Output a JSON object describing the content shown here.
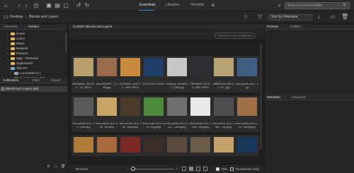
{
  "topbar": {
    "workspaces": [
      "Essentials",
      "Libraries",
      "Filmstrip"
    ],
    "search_placeholder": "Search Current Folder"
  },
  "pathbar": {
    "crumbs": [
      "Desktop",
      "Blends and Layers"
    ],
    "sort_label": "Sort by Filename"
  },
  "left_panel": {
    "tabs": [
      "Favorites",
      "Folders"
    ],
    "tree": [
      {
        "label": "Home",
        "icon": "folder"
      },
      {
        "label": "Junior",
        "icon": "folder"
      },
      {
        "label": "Music",
        "icon": "folder"
      },
      {
        "label": "Network",
        "icon": "folder"
      },
      {
        "label": "Pictures",
        "icon": "folder"
      },
      {
        "label": "Saje - Personal",
        "icon": "folder"
      },
      {
        "label": "Sophomore",
        "icon": "folder"
      },
      {
        "label": "This PC",
        "icon": "pc"
      },
      {
        "label": "Local Disk (C:)",
        "icon": "disk"
      },
      {
        "label": "Google Drive (G:)",
        "icon": "gdrive"
      },
      {
        "label": "My Drive",
        "icon": "folder"
      },
      {
        "label": "Academic Archive",
        "icon": "folder"
      }
    ]
  },
  "collections_panel": {
    "tabs": [
      "Collections",
      "Filter",
      "Export"
    ],
    "items": [
      {
        "label": "Blends and Layers (86)"
      }
    ]
  },
  "content": {
    "title": "Content: Blends and Layers",
    "remove_button": "Remove From Collection",
    "items_count": "86 items",
    "tiles_label": "Tiles",
    "thumbs_label": "Thumbnails Only",
    "files": [
      {
        "label": "A6FBB6A-7DF B-4...2C.JPEG",
        "color": "#b9a06a"
      },
      {
        "label": "b4d-899f337_1 280.jpg",
        "color": "#9a6b4a"
      },
      {
        "label": "C47506C-4AD F-4...A6F.JPEG",
        "color": "#c98a3d"
      },
      {
        "label": "DSC01447.JPEG",
        "color": "#1f3f6a"
      },
      {
        "label": "embeze-9F288 67_1280.jpg",
        "color": "#c7c7c7"
      },
      {
        "label": "F0E9E82-210 9-4...B62.JPEG",
        "color": "#2f2f33"
      },
      {
        "label": "f8B8F241-859 f-f...bf...jpg",
        "color": "#b8a274"
      },
      {
        "label": "free-photo-of-a ...jpg",
        "color": "#3e5f82"
      },
      {
        "label": "free-photo-of-a -cu...own.jpg",
        "color": "#5a5a5a"
      },
      {
        "label": "free-photo-of-a -hot...ze.jpeg",
        "color": "#c9a468"
      },
      {
        "label": "free-photo-of-a -far...loor.jpeg",
        "color": "#4b3b2b"
      },
      {
        "label": "free-photo-of-a -win...ing.jpeg",
        "color": "#4d8a3a"
      },
      {
        "label": "free-photo-of-a -boy-...ucer.jpeg",
        "color": "#6f6f6f"
      },
      {
        "label": "free-photo-of-a -tone...ins.jpeg",
        "color": "#e8e8e8"
      },
      {
        "label": "free-photo-of-a -own...-up.jpeg",
        "color": "#4e4e4e"
      },
      {
        "label": "free-photo-of-a -ord...ored.jpeg",
        "color": "#a07048"
      },
      {
        "label": "",
        "color": "#b07a3a"
      },
      {
        "label": "",
        "color": "#a86a3c"
      },
      {
        "label": "",
        "color": "#7a2a22"
      },
      {
        "label": "",
        "color": "#3c2c26"
      },
      {
        "label": "",
        "color": "#5a4a3e"
      },
      {
        "label": "",
        "color": "#6a5a48"
      },
      {
        "label": "",
        "color": "#c6a26a"
      },
      {
        "label": "",
        "color": "#17385a"
      }
    ]
  },
  "right_panel": {
    "top_tabs": [
      "Preview",
      "Publish"
    ],
    "bottom_tabs": [
      "Metadata",
      "Keywords"
    ]
  }
}
